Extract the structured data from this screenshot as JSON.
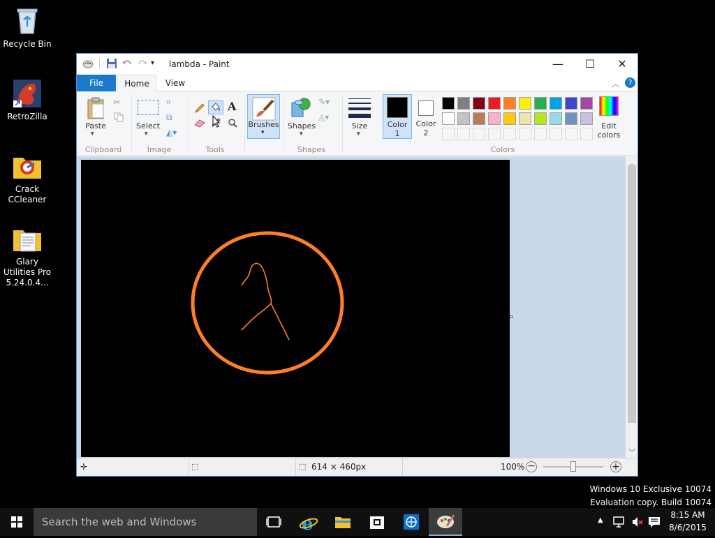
{
  "desktop": {
    "icons": [
      {
        "label": "Recycle Bin"
      },
      {
        "label": "RetroZilla"
      },
      {
        "label": "Crack CCleaner"
      },
      {
        "label": "Glary Utilities Pro 5.24.0.4..."
      }
    ],
    "watermark": {
      "line1": "Windows 10 Exclusive 10074",
      "line2": "Evaluation copy. Build 10074"
    }
  },
  "window": {
    "title": "lambda - Paint",
    "tabs": {
      "file": "File",
      "home": "Home",
      "view": "View"
    },
    "ribbon": {
      "clipboard": {
        "paste": "Paste",
        "label": "Clipboard"
      },
      "image": {
        "select": "Select",
        "label": "Image"
      },
      "tools": {
        "label": "Tools"
      },
      "brushes": {
        "label": "Brushes"
      },
      "shapes": {
        "button": "Shapes",
        "label": "Shapes"
      },
      "size": {
        "label": "Size"
      },
      "color1": {
        "line1": "Color",
        "line2": "1"
      },
      "color2": {
        "line1": "Color",
        "line2": "2"
      },
      "edit_colors": {
        "line1": "Edit",
        "line2": "colors"
      },
      "colors_label": "Colors",
      "palette_row1": [
        "#000000",
        "#7f7f7f",
        "#880015",
        "#ed1c24",
        "#ff7f27",
        "#fff200",
        "#22b14c",
        "#00a2e8",
        "#3f48cc",
        "#a349a4"
      ],
      "palette_row2": [
        "#ffffff",
        "#c3c3c3",
        "#b97a57",
        "#ffaec9",
        "#ffc90e",
        "#efe4b0",
        "#b5e61d",
        "#99d9ea",
        "#7092be",
        "#c8bfe7"
      ]
    },
    "status": {
      "dimensions": "614 × 460px",
      "zoom": "100%"
    }
  },
  "taskbar": {
    "search_placeholder": "Search the web and Windows",
    "clock": {
      "time": "8:15 AM",
      "date": "8/6/2015"
    }
  },
  "colors": {
    "accent": "#1979ca",
    "drawing": "#ff7f27"
  }
}
